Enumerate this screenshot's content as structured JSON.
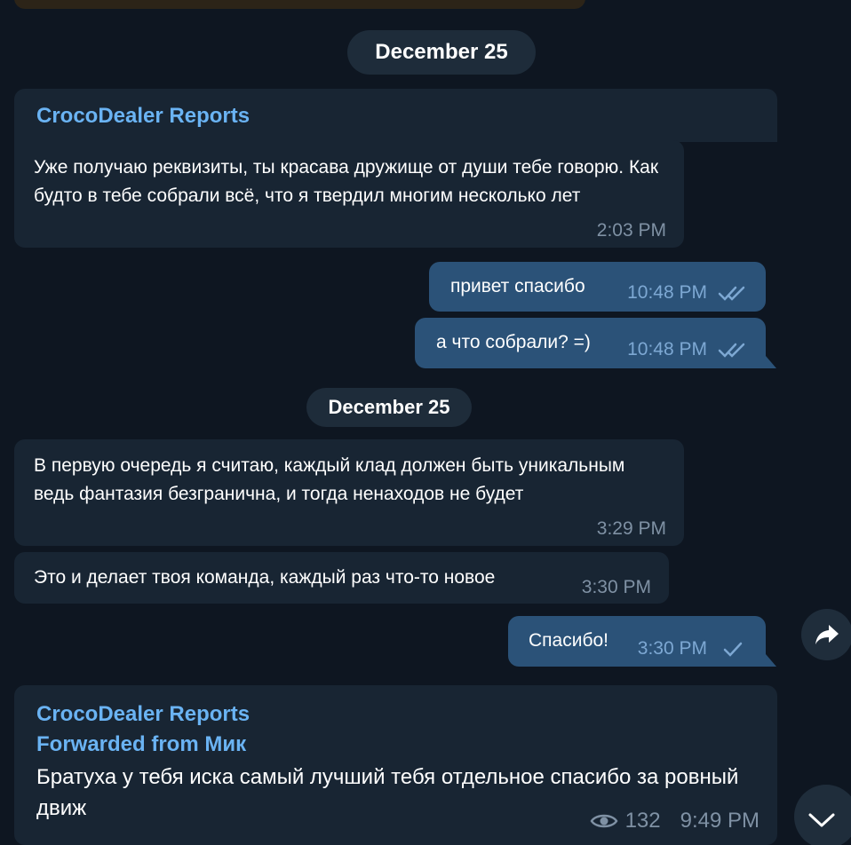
{
  "dates": {
    "first": "December 25",
    "second": "December 25"
  },
  "messages": {
    "m1": {
      "sender": "CrocoDealer Reports",
      "text": "Уже получаю реквизиты, ты красава дружище от души тебе говорю. Как будто в тебе собрали всё, что я твердил многим несколько лет",
      "time": "2:03 PM"
    },
    "m2": {
      "text": "привет спасибо",
      "time": "10:48 PM"
    },
    "m3": {
      "text": "а что собрали? =)",
      "time": "10:48 PM"
    },
    "m4": {
      "text": "В первую очередь я считаю, каждый клад должен быть уникальным ведь фантазия безгранична, и тогда ненаходов не будет",
      "time": "3:29 PM"
    },
    "m5": {
      "text": "Это и делает твоя команда, каждый раз что-то новое",
      "time": "3:30 PM"
    },
    "m6": {
      "text": "Спасибо!",
      "time": "3:30 PM"
    },
    "m7": {
      "sender": "CrocoDealer Reports",
      "forwarded": "Forwarded from Мик",
      "text": "Братуха у тебя иска самый лучший тебя отдельное спасибо за ровный движ",
      "views": "132",
      "time": "9:49 PM"
    }
  },
  "icons": {
    "double_check": "double-check-icon",
    "single_check": "check-icon",
    "share": "share-arrow-icon",
    "scroll_down": "chevron-down-icon",
    "views": "eye-icon"
  },
  "colors": {
    "background": "#0e1621",
    "incoming": "#182533",
    "outgoing": "#2b5278",
    "accent": "#6ab3f3"
  }
}
